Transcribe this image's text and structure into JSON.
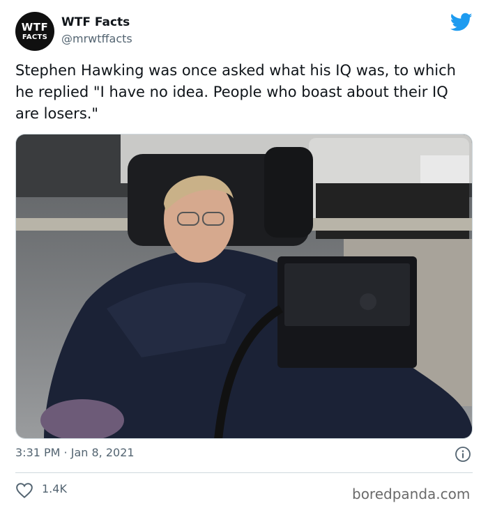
{
  "account": {
    "avatar_line1": "WTF",
    "avatar_line2": "FACTS",
    "display_name": "WTF Facts",
    "handle": "@mrwtffacts"
  },
  "tweet": {
    "text": "Stephen Hawking was once asked what his IQ was, to which he replied \"I have no idea. People who boast about their IQ are losers.\"",
    "timestamp": "3:31 PM · Jan 8, 2021",
    "like_count": "1.4K"
  },
  "watermark": "boredpanda.com",
  "icons": {
    "brand": "twitter-bird-icon",
    "info": "info-icon",
    "like": "heart-icon"
  },
  "colors": {
    "twitter_blue": "#1d9bf0",
    "text_primary": "#0f1419",
    "text_secondary": "#536471",
    "border": "#cfd9de"
  }
}
